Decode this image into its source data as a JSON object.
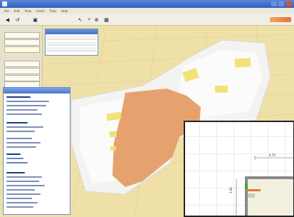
{
  "window": {
    "title": "",
    "accent_color": "#2f5cc0"
  },
  "menu": {
    "items": [
      "File",
      "Edit",
      "View",
      "Insert",
      "Tools",
      "Help"
    ]
  },
  "toolbar": {
    "icons": [
      "back-icon",
      "undo-icon",
      "print-icon",
      "pointer-icon",
      "search-icon",
      "zoom-icon",
      "grid-icon"
    ]
  },
  "left_panel": {
    "buttons": [
      "",
      "",
      "",
      "",
      "",
      "",
      ""
    ]
  },
  "scene": {
    "floor_color": "#efe0a8",
    "wall_color": "#f4f4f4",
    "carpet_color": "#e6a26e"
  },
  "inset": {
    "dimension_top": "4.70",
    "dimension_side": "3.90"
  }
}
